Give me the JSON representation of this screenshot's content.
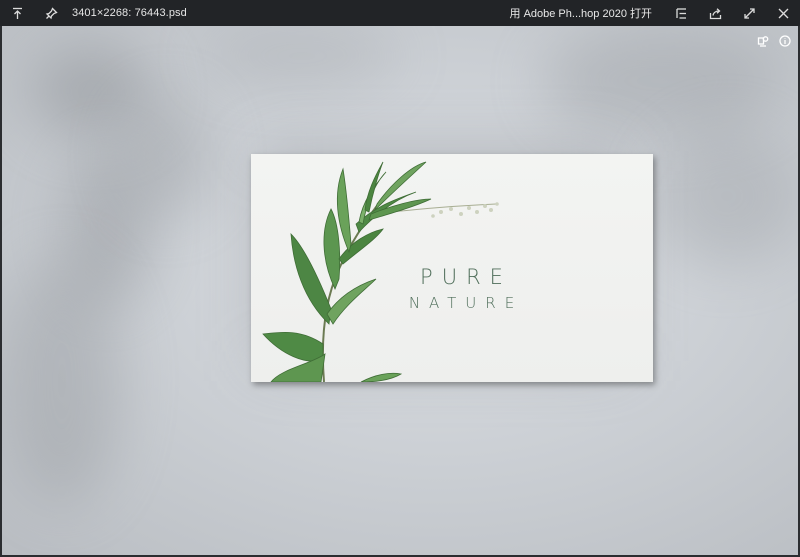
{
  "titlebar": {
    "filename": "3401×2268: 76443.psd",
    "open_with_label": "用 Adobe Ph...hop 2020 打开"
  },
  "icons": {
    "pin_top": "pin-to-top-icon",
    "pin": "pin-icon",
    "list": "list-icon",
    "share": "share-icon",
    "fullscreen": "fullscreen-icon",
    "close": "close-icon",
    "color_picker": "color-picker-icon",
    "info": "info-icon"
  },
  "card": {
    "line1": "PURE",
    "line2": "NATURE"
  },
  "colors": {
    "titlebar_bg": "#222427",
    "card_text": "#4f6e5a",
    "leaf_green": "#4f8a45"
  }
}
